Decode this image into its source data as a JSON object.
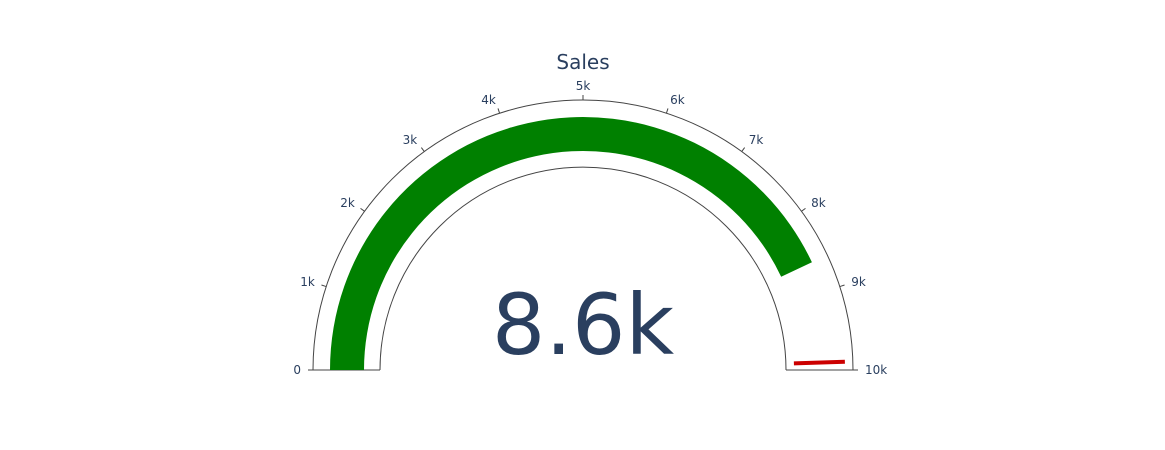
{
  "chart_data": {
    "type": "gauge",
    "title": "Sales",
    "value": 8600,
    "value_label": "8.6k",
    "range": [
      0,
      10000
    ],
    "ticks": [
      {
        "value": 0,
        "label": "0"
      },
      {
        "value": 1000,
        "label": "1k"
      },
      {
        "value": 2000,
        "label": "2k"
      },
      {
        "value": 3000,
        "label": "3k"
      },
      {
        "value": 4000,
        "label": "4k"
      },
      {
        "value": 5000,
        "label": "5k"
      },
      {
        "value": 6000,
        "label": "6k"
      },
      {
        "value": 7000,
        "label": "7k"
      },
      {
        "value": 8000,
        "label": "8k"
      },
      {
        "value": 9000,
        "label": "9k"
      },
      {
        "value": 10000,
        "label": "10k"
      }
    ],
    "threshold": 9900,
    "bar_color": "#008000",
    "threshold_color": "#cc0000",
    "axis_color": "#444444",
    "text_color": "#2a3f5f"
  }
}
